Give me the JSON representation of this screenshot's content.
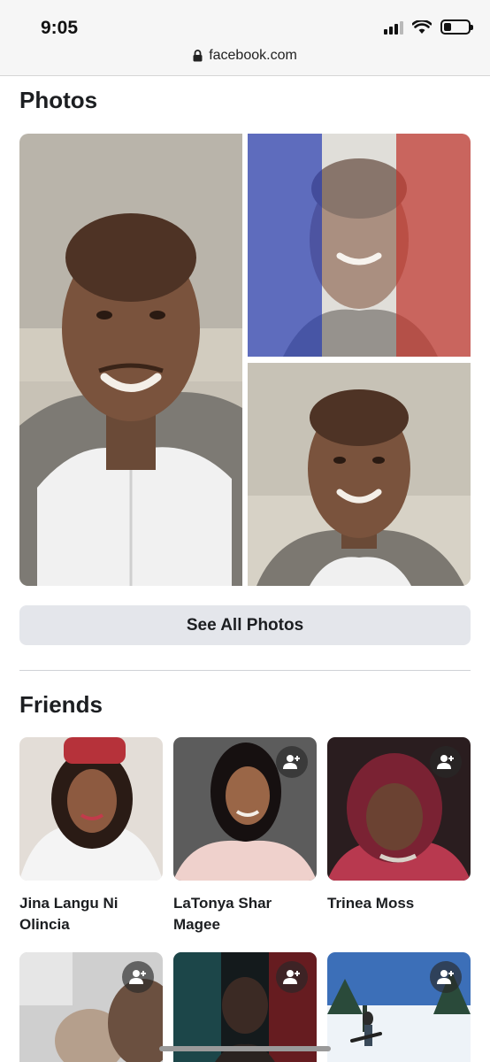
{
  "status_bar": {
    "time": "9:05"
  },
  "browser": {
    "url": "facebook.com",
    "lock_icon": "lock-icon"
  },
  "photos_section": {
    "title": "Photos",
    "photos": [
      {
        "description_icon": "photo-portrait"
      },
      {
        "description_icon": "photo-french-flag-filter"
      },
      {
        "description_icon": "photo-portrait"
      }
    ],
    "see_all_label": "See All Photos"
  },
  "friends_section": {
    "title": "Friends",
    "friends": [
      {
        "name": "Jina Langu Ni Olincia",
        "has_add_button": false
      },
      {
        "name": "LaTonya Shar Magee",
        "has_add_button": true
      },
      {
        "name": "Trinea Moss",
        "has_add_button": true
      },
      {
        "name": "",
        "has_add_button": true
      },
      {
        "name": "",
        "has_add_button": true
      },
      {
        "name": "",
        "has_add_button": true
      }
    ]
  },
  "colors": {
    "flag_blue": "#3c4fb8",
    "flag_red": "#c64a42",
    "button_bg": "#e4e6eb"
  }
}
